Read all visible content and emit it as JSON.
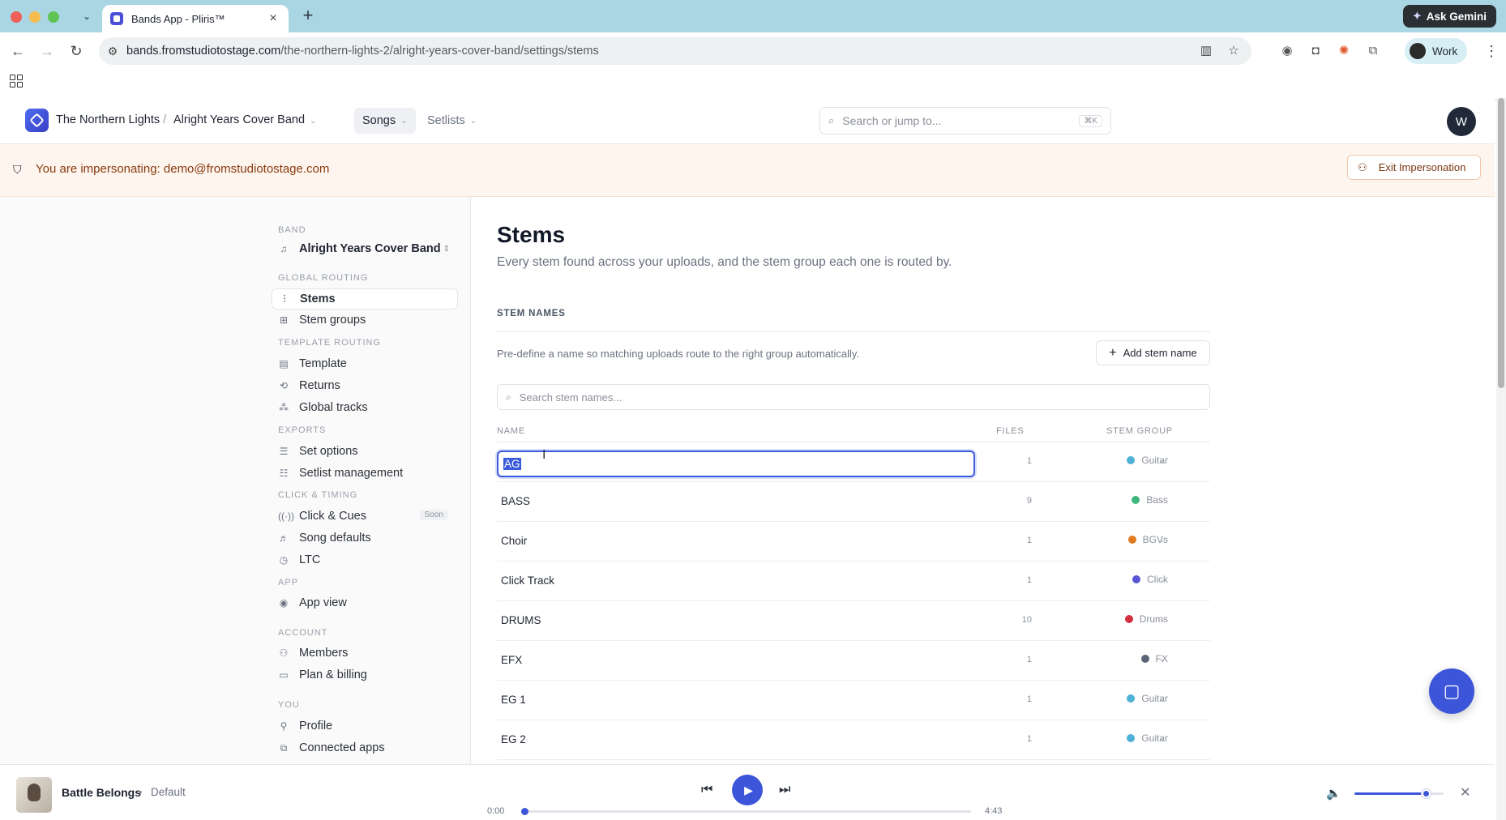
{
  "browser": {
    "tab_title": "Bands App - Pliris™",
    "url_domain": "bands.fromstudiotostage.com",
    "url_path": "/the-northern-lights-2/alright-years-cover-band/settings/stems",
    "profile_label": "Work",
    "ask_gemini_label": "Ask Gemini"
  },
  "header": {
    "org": "The Northern Lights",
    "band": "Alright Years Cover Band",
    "tabs": [
      {
        "label": "Songs",
        "active": true
      },
      {
        "label": "Setlists",
        "active": false
      }
    ],
    "search_placeholder": "Search or jump to...",
    "search_shortcut": "⌘K",
    "avatar_initial": "W"
  },
  "banner": {
    "text": "You are impersonating: demo@fromstudiotostage.com",
    "exit_label": "Exit Impersonation"
  },
  "sidebar": {
    "band_section": "BAND",
    "band_name": "Alright Years Cover Band",
    "sections": {
      "global_routing": "GLOBAL ROUTING",
      "template_routing": "TEMPLATE ROUTING",
      "exports": "EXPORTS",
      "click_timing": "CLICK & TIMING",
      "app": "APP",
      "account": "ACCOUNT",
      "you": "YOU"
    },
    "items": {
      "stems": "Stems",
      "stem_groups": "Stem groups",
      "template": "Template",
      "returns": "Returns",
      "global_tracks": "Global tracks",
      "set_options": "Set options",
      "setlist_management": "Setlist management",
      "click_cues": "Click & Cues",
      "soon_badge": "Soon",
      "song_defaults": "Song defaults",
      "ltc": "LTC",
      "app_view": "App view",
      "members": "Members",
      "plan_billing": "Plan & billing",
      "profile": "Profile",
      "connected_apps": "Connected apps"
    }
  },
  "page": {
    "title": "Stems",
    "subtitle": "Every stem found across your uploads, and the stem group each one is routed by.",
    "section_label": "STEM NAMES",
    "helper": "Pre-define a name so matching uploads route to the right group automatically.",
    "add_label": "Add stem name",
    "search_placeholder": "Search stem names...",
    "columns": {
      "name": "NAME",
      "files": "FILES",
      "group": "STEM GROUP"
    },
    "editing_value": "AG",
    "rows": [
      {
        "name": "AG",
        "files": "1",
        "group": "Guitar",
        "color": "#4fb0d8"
      },
      {
        "name": "BASS",
        "files": "9",
        "group": "Bass",
        "color": "#3fb67a"
      },
      {
        "name": "Choir",
        "files": "1",
        "group": "BGVs",
        "color": "#e07b1f"
      },
      {
        "name": "Click Track",
        "files": "1",
        "group": "Click",
        "color": "#5a55d6"
      },
      {
        "name": "DRUMS",
        "files": "10",
        "group": "Drums",
        "color": "#d62f3f"
      },
      {
        "name": "EFX",
        "files": "1",
        "group": "FX",
        "color": "#5c6478"
      },
      {
        "name": "EG 1",
        "files": "1",
        "group": "Guitar",
        "color": "#4fb0d8"
      },
      {
        "name": "EG 2",
        "files": "1",
        "group": "Guitar",
        "color": "#4fb0d8"
      }
    ]
  },
  "player": {
    "song": "Battle Belongs",
    "separator": "•",
    "variant": "Default",
    "elapsed": "0:00",
    "duration": "4:43",
    "progress": 0,
    "volume": 0.8
  }
}
